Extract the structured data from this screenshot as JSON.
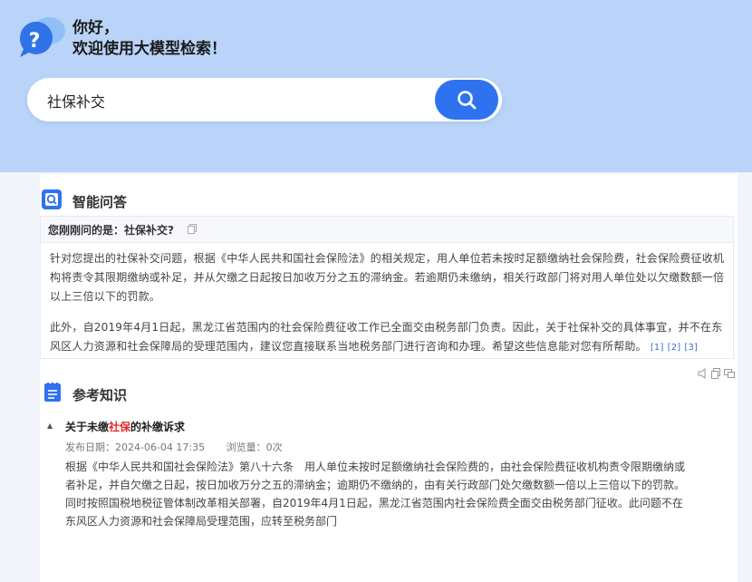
{
  "header": {
    "greeting_line1": "你好，",
    "greeting_line2": "欢迎使用大模型检索！"
  },
  "search": {
    "value": "社保补交"
  },
  "qa": {
    "section_title": "智能问答",
    "question": "您刚刚问的是：社保补交?",
    "paragraph1": "针对您提出的社保补交问题，根据《中华人民共和国社会保险法》的相关规定，用人单位若未按时足额缴纳社会保险费，社会保险费征收机构将责令其限期缴纳或补足，并从欠缴之日起按日加收万分之五的滞纳金。若逾期仍未缴纳，相关行政部门将对用人单位处以欠缴数额一倍以上三倍以下的罚款。",
    "paragraph2": "此外，自2019年4月1日起，黑龙江省范围内的社会保险费征收工作已全面交由税务部门负责。因此，关于社保补交的具体事宜，并不在东风区人力资源和社会保障局的受理范围内，建议您直接联系当地税务部门进行咨询和办理。希望这些信息能对您有所帮助。",
    "refs": [
      "[1]",
      "[2]",
      "[3]"
    ]
  },
  "reference": {
    "section_title": "参考知识",
    "item": {
      "title_prefix": "关于未缴",
      "title_highlight": "社保",
      "title_suffix": "的补缴诉求",
      "date_label": "发布日期：2024-06-04 17:35",
      "views_label": "浏览量：0次",
      "body_line1": "根据《中华人民共和国社会保险法》第八十六条　用人单位未按时足额缴纳社会保险费的，由社会保险费征收机构责令限期缴纳或者补足，并自欠缴之日起，按日加收万分之五的滞纳金；逾期仍不缴纳的，由有关行政部门处欠缴数额一倍以上三倍以下的罚款。",
      "body_line2": "同时按照国税地税征管体制改革相关部署，自2019年4月1日起，黑龙江省范围内社会保险费全面交由税务部门征收。此问题不在东风区人力资源和社会保障局受理范围，应转至税务部门"
    }
  },
  "colors": {
    "hero_bg": "#b9d4f8",
    "accent": "#2f72f0",
    "highlight": "#e5262a"
  }
}
